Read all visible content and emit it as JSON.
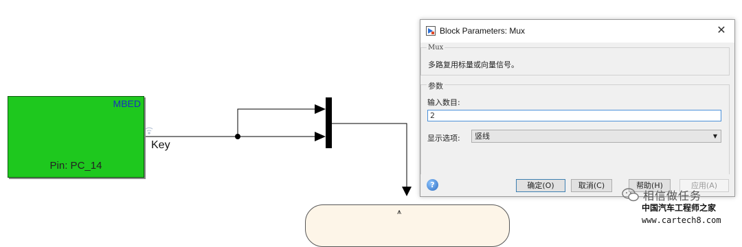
{
  "diagram": {
    "source_block": {
      "title": "MBED",
      "pin_label": "Pin: PC_14"
    },
    "signal_label": "Key",
    "chart_block_label": "⩚"
  },
  "dialog": {
    "title": "Block Parameters: Mux",
    "block_type": "Mux",
    "description": "多路复用标量或向量信号。",
    "params_group": "参数",
    "num_inputs_label": "输入数目:",
    "num_inputs_value": "2",
    "display_option_label": "显示选项:",
    "display_option_value": "竖线",
    "buttons": {
      "ok": "确定(O)",
      "cancel": "取消(C)",
      "help": "帮助(H)",
      "apply": "应用(A)"
    }
  },
  "watermark": {
    "name": "相信做任务",
    "cn_site": "中国汽车工程师之家",
    "url": "www.cartech8.com"
  },
  "colors": {
    "block_green": "#1ec81e",
    "mbed_blue": "#1a2fbf",
    "dialog_bg": "#f0f0f0",
    "input_focus": "#4a90d9"
  }
}
